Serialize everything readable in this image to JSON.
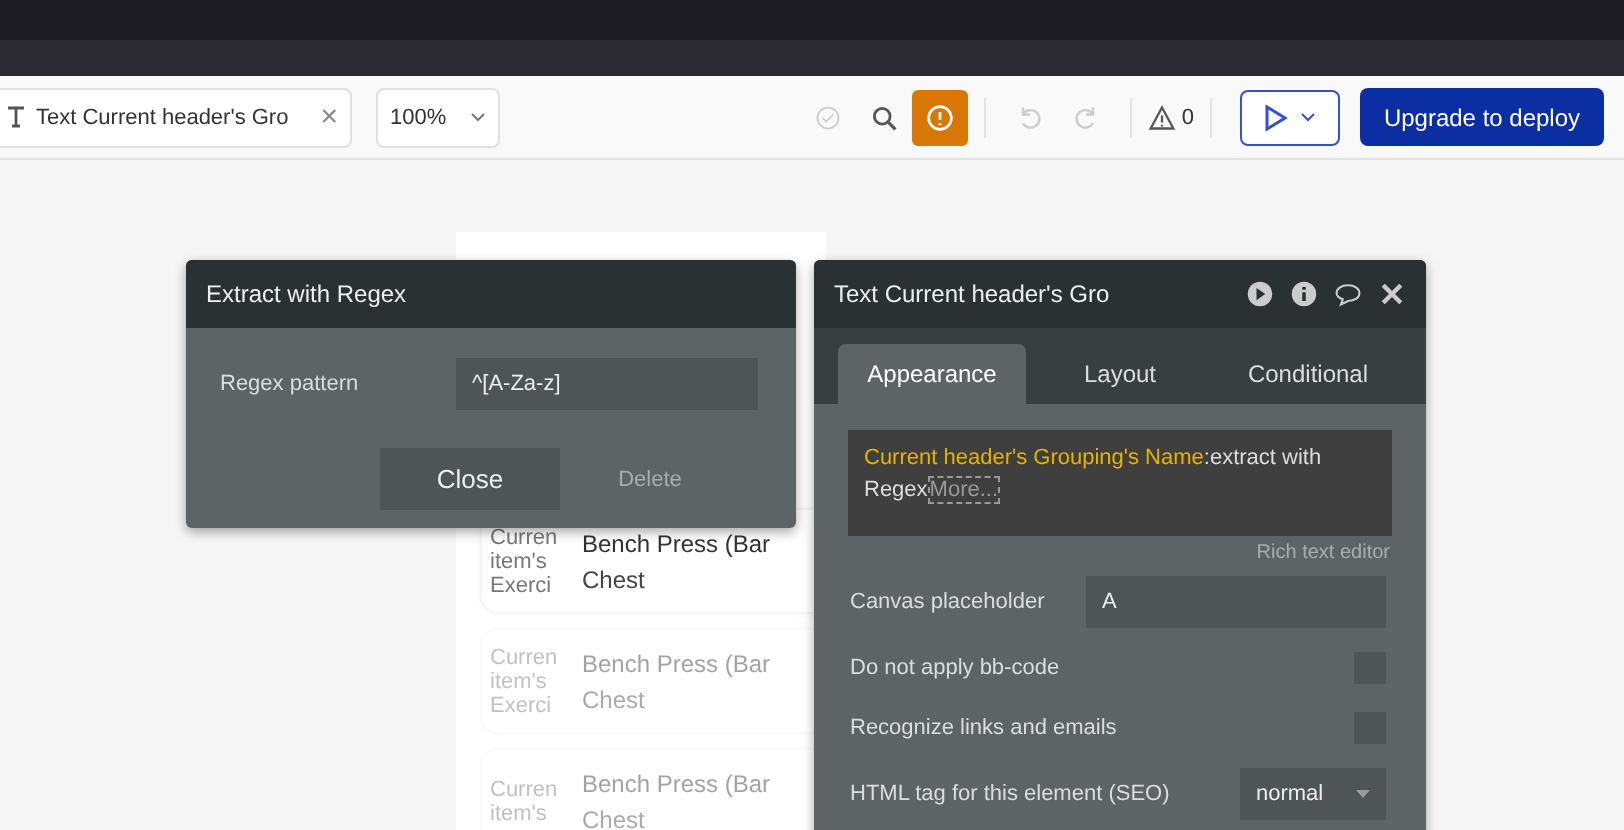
{
  "toolbar": {
    "element_tab": {
      "label": "Text Current header's Gro",
      "close": "×"
    },
    "zoom": "100%",
    "issue_count": "0",
    "upgrade_button": "Upgrade to deploy",
    "preview_selected": true
  },
  "canvas": {
    "cards": [
      {
        "thumb": "Curren item's Exerci",
        "title": "Bench Press (Bar",
        "subtitle": "Chest",
        "faded": false
      },
      {
        "thumb": "Curren item's Exerci",
        "title": "Bench Press (Bar",
        "subtitle": "Chest",
        "faded": true
      },
      {
        "thumb": "Curren item's",
        "title": "Bench Press (Bar",
        "subtitle": "Chest",
        "faded": true
      }
    ]
  },
  "regex_panel": {
    "title": "Extract with Regex",
    "label": "Regex pattern",
    "value": "^[A-Za-z]",
    "buttons": [
      {
        "label": "Close",
        "kind": "primary"
      },
      {
        "label": "Delete",
        "kind": "ghost"
      }
    ]
  },
  "property_panel": {
    "title": "Text Current header's Gro",
    "tabs": [
      {
        "label": "Appearance",
        "selected": true
      },
      {
        "label": "Layout",
        "selected": false
      },
      {
        "label": "Conditional",
        "selected": false
      }
    ],
    "editor": {
      "expression": "Current header's Grouping's Name",
      "rest": ":extract with Regex",
      "more": "More..."
    },
    "editor_hint": "Rich text editor",
    "rows": [
      {
        "kind": "input",
        "label": "Canvas placeholder",
        "value": "A"
      },
      {
        "kind": "checkbox",
        "label": "Do not apply bb-code",
        "checked": false
      },
      {
        "kind": "checkbox",
        "label": "Recognize links and emails",
        "checked": false
      },
      {
        "kind": "select",
        "label": "HTML tag for this element (SEO)",
        "value": "normal"
      }
    ]
  }
}
